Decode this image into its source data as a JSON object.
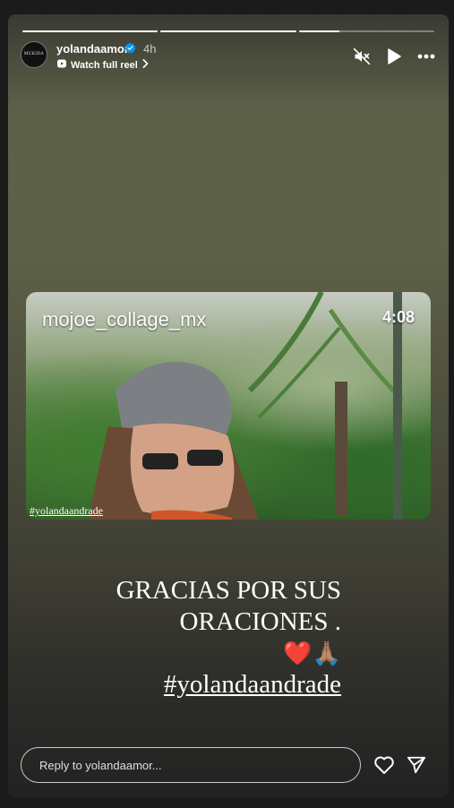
{
  "story": {
    "progress": [
      1.0,
      1.0,
      0.3
    ],
    "avatar_text": "MUKIDA",
    "username": "yolandaamor",
    "time_ago": "4h",
    "watch_reel_label": "Watch full reel",
    "icons": {
      "verified": "verified-icon",
      "reel": "reel-icon",
      "chevron": "chevron-right-icon",
      "mute": "muted-speaker-icon",
      "play": "play-icon",
      "more": "more-horizontal-icon"
    }
  },
  "media": {
    "watermark": "mojoe_collage_mx",
    "duration": "4:08",
    "tag": "#yolandaandrade"
  },
  "caption": {
    "line1": "GRACIAS POR SUS",
    "line2": "ORACIONES .",
    "emoji": "❤️🙏🏽",
    "hashtag": "#yolandaandrade"
  },
  "footer": {
    "reply_placeholder": "Reply to yolandaamor...",
    "icons": {
      "like": "heart-icon",
      "send": "send-icon"
    }
  },
  "colors": {
    "verified_blue": "#0095f6",
    "heart_red": "#e1132b"
  }
}
